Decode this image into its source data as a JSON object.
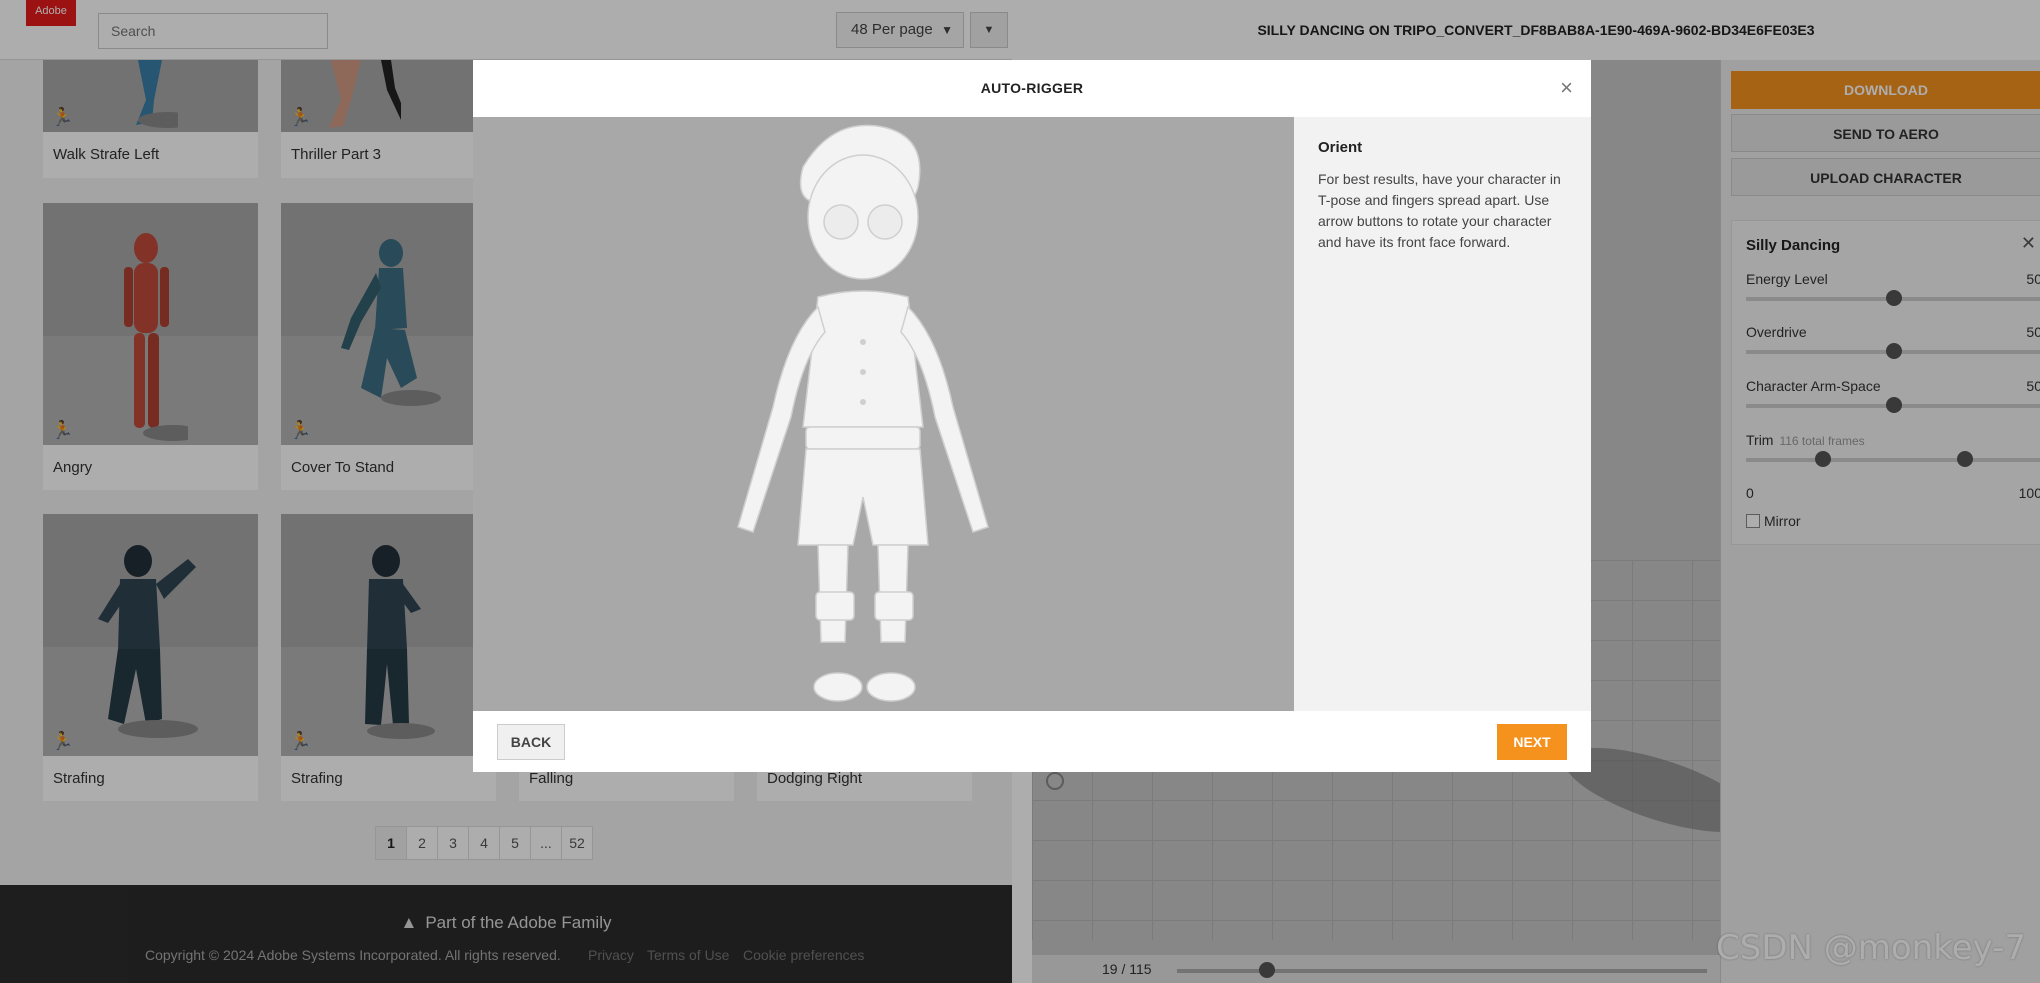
{
  "header": {
    "logo_text": "Adobe",
    "search_placeholder": "Search",
    "per_page": "48 Per page",
    "animation_title": "SILLY DANCING ON TRIPO_CONVERT_DF8BAB8A-1E90-469A-9602-BD34E6FE03E3"
  },
  "cards": [
    {
      "label": "Walk Strafe Left"
    },
    {
      "label": "Thriller Part 3"
    },
    {
      "label": "Angry"
    },
    {
      "label": "Cover To Stand"
    },
    {
      "label": "Strafing"
    },
    {
      "label": "Strafing"
    },
    {
      "label": "Falling"
    },
    {
      "label": "Dodging Right"
    }
  ],
  "pager": {
    "pages": [
      "1",
      "2",
      "3",
      "4",
      "5",
      "...",
      "52"
    ],
    "active": "1"
  },
  "footer": {
    "family": "Part of the Adobe Family",
    "copyright": "Copyright © 2024 Adobe Systems Incorporated. All rights reserved.",
    "links": [
      "Privacy",
      "Terms of Use",
      "Cookie preferences"
    ]
  },
  "sidebar": {
    "download": "DOWNLOAD",
    "send": "SEND TO AERO",
    "upload": "UPLOAD CHARACTER",
    "panel_title": "Silly Dancing",
    "params": [
      {
        "name": "Energy Level",
        "value": "50",
        "fraction": 0.5
      },
      {
        "name": "Overdrive",
        "value": "50",
        "fraction": 0.5
      },
      {
        "name": "Character Arm-Space",
        "value": "50",
        "fraction": 0.5
      }
    ],
    "trim": {
      "label": "Trim",
      "sub": "116 total frames",
      "min": "0",
      "max": "100",
      "start_fraction": 0.26,
      "end_fraction": 0.74
    },
    "mirror": "Mirror"
  },
  "timeline": {
    "frames": "19 / 115",
    "fraction": 0.17
  },
  "modal": {
    "title": "AUTO-RIGGER",
    "close": "×",
    "step_title": "Orient",
    "step_text": "For best results, have your character in T-pose and fingers spread apart. Use arrow buttons to rotate your character and have its front face forward.",
    "back": "BACK",
    "next": "NEXT"
  },
  "watermark": "CSDN @monkey-7",
  "colors": {
    "accent": "#f5921e",
    "brand": "#e61a1a"
  }
}
